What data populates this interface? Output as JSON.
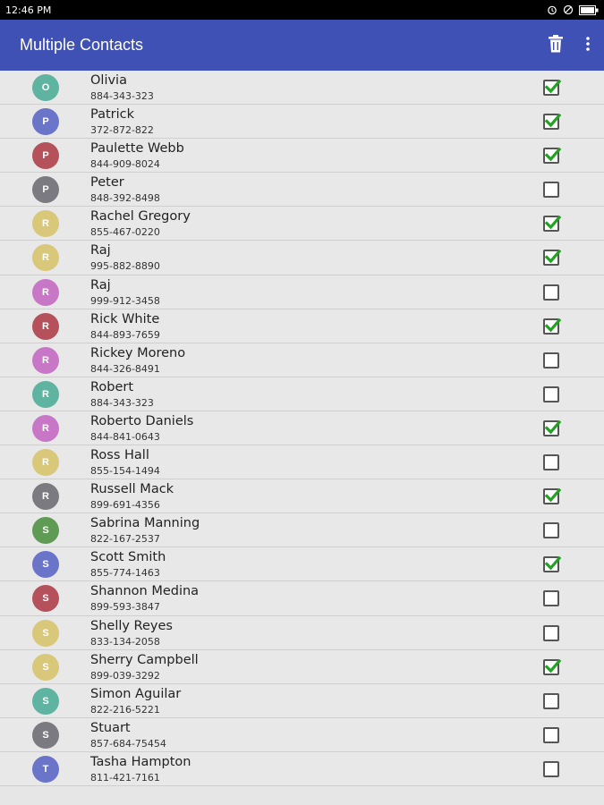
{
  "status_bar": {
    "time": "12:46 PM"
  },
  "app_bar": {
    "title": "Multiple Contacts",
    "actions": [
      "trash-icon",
      "more-vert-icon"
    ]
  },
  "colors": {
    "app_bar": "#3f51b5",
    "check": "#22a122",
    "avatar_teal": "#5fb3a1",
    "avatar_indigo": "#6a74c9",
    "avatar_red": "#b5515a",
    "avatar_gray": "#7a7a80",
    "avatar_yellow": "#d9c77a",
    "avatar_pink": "#c877c7",
    "avatar_green": "#5f9b55"
  },
  "contacts": [
    {
      "initial": "O",
      "name": "Olivia",
      "phone": "884-343-323",
      "checked": true,
      "color": "#5fb3a1"
    },
    {
      "initial": "P",
      "name": "Patrick",
      "phone": "372-872-822",
      "checked": true,
      "color": "#6a74c9"
    },
    {
      "initial": "P",
      "name": "Paulette Webb",
      "phone": "844-909-8024",
      "checked": true,
      "color": "#b5515a"
    },
    {
      "initial": "P",
      "name": "Peter",
      "phone": "848-392-8498",
      "checked": false,
      "color": "#7a7a80"
    },
    {
      "initial": "R",
      "name": "Rachel Gregory",
      "phone": "855-467-0220",
      "checked": true,
      "color": "#d9c77a"
    },
    {
      "initial": "R",
      "name": "Raj",
      "phone": "995-882-8890",
      "checked": true,
      "color": "#d9c77a"
    },
    {
      "initial": "R",
      "name": "Raj",
      "phone": "999-912-3458",
      "checked": false,
      "color": "#c877c7"
    },
    {
      "initial": "R",
      "name": "Rick White",
      "phone": "844-893-7659",
      "checked": true,
      "color": "#b5515a"
    },
    {
      "initial": "R",
      "name": "Rickey Moreno",
      "phone": "844-326-8491",
      "checked": false,
      "color": "#c877c7"
    },
    {
      "initial": "R",
      "name": "Robert",
      "phone": "884-343-323",
      "checked": false,
      "color": "#5fb3a1"
    },
    {
      "initial": "R",
      "name": "Roberto Daniels",
      "phone": "844-841-0643",
      "checked": true,
      "color": "#c877c7"
    },
    {
      "initial": "R",
      "name": "Ross Hall",
      "phone": "855-154-1494",
      "checked": false,
      "color": "#d9c77a"
    },
    {
      "initial": "R",
      "name": "Russell Mack",
      "phone": "899-691-4356",
      "checked": true,
      "color": "#7a7a80"
    },
    {
      "initial": "S",
      "name": "Sabrina Manning",
      "phone": "822-167-2537",
      "checked": false,
      "color": "#5f9b55"
    },
    {
      "initial": "S",
      "name": "Scott Smith",
      "phone": "855-774-1463",
      "checked": true,
      "color": "#6a74c9"
    },
    {
      "initial": "S",
      "name": "Shannon Medina",
      "phone": "899-593-3847",
      "checked": false,
      "color": "#b5515a"
    },
    {
      "initial": "S",
      "name": "Shelly Reyes",
      "phone": "833-134-2058",
      "checked": false,
      "color": "#d9c77a"
    },
    {
      "initial": "S",
      "name": "Sherry Campbell",
      "phone": "899-039-3292",
      "checked": true,
      "color": "#d9c77a"
    },
    {
      "initial": "S",
      "name": "Simon Aguilar",
      "phone": "822-216-5221",
      "checked": false,
      "color": "#5fb3a1"
    },
    {
      "initial": "S",
      "name": "Stuart",
      "phone": "857-684-75454",
      "checked": false,
      "color": "#7a7a80"
    },
    {
      "initial": "T",
      "name": "Tasha Hampton",
      "phone": "811-421-7161",
      "checked": false,
      "color": "#6a74c9"
    }
  ]
}
